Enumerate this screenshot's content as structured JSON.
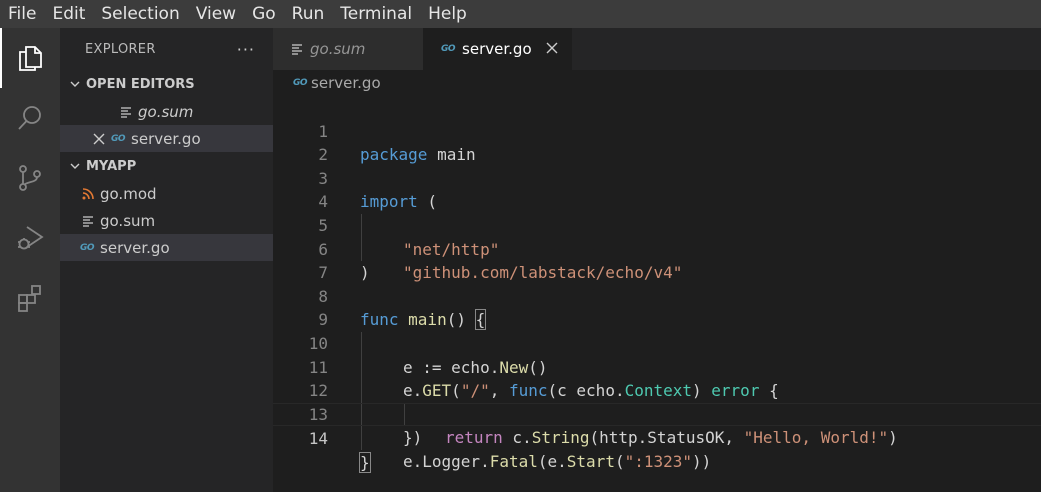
{
  "menubar": {
    "items": [
      "File",
      "Edit",
      "Selection",
      "View",
      "Go",
      "Run",
      "Terminal",
      "Help"
    ]
  },
  "activitybar": {
    "items": [
      {
        "icon": "files-icon",
        "active": true
      },
      {
        "icon": "search-icon",
        "active": false
      },
      {
        "icon": "source-control-icon",
        "active": false
      },
      {
        "icon": "run-debug-icon",
        "active": false
      },
      {
        "icon": "extensions-icon",
        "active": false
      }
    ]
  },
  "sidebar": {
    "title": "EXPLORER",
    "more": "···",
    "open_editors": {
      "label": "OPEN EDITORS",
      "items": [
        {
          "name": "go.sum",
          "icon": "lines-icon"
        },
        {
          "name": "server.go",
          "icon": "go-icon"
        }
      ]
    },
    "project": {
      "label": "MYAPP",
      "items": [
        {
          "name": "go.mod",
          "icon": "rss-icon"
        },
        {
          "name": "go.sum",
          "icon": "lines-icon"
        },
        {
          "name": "server.go",
          "icon": "go-icon"
        }
      ]
    }
  },
  "tabs": [
    {
      "label": "go.sum",
      "active": false
    },
    {
      "label": "server.go",
      "active": true
    }
  ],
  "breadcrumb": "server.go",
  "icon_text": {
    "go": "GO"
  },
  "code": {
    "current_line": 14,
    "line_numbers": [
      "1",
      "2",
      "3",
      "4",
      "5",
      "6",
      "7",
      "8",
      "9",
      "10",
      "11",
      "12",
      "13",
      "14"
    ],
    "tokens": {
      "l1_kw": "package",
      "l1_name": " main",
      "l3_kw": "import",
      "l3_paren": " (",
      "l4_str": "\"net/http\"",
      "l5_str": "\"github.com/labstack/echo/v4\"",
      "l6": ")",
      "l8_kw": "func",
      "l8_fn": " main",
      "l8_rest": "() ",
      "l8_brace": "{",
      "l9_a": "e := echo.",
      "l9_fn": "New",
      "l9_b": "()",
      "l10_a": "e.",
      "l10_fn": "GET",
      "l10_b": "(",
      "l10_str": "\"/\"",
      "l10_c": ", ",
      "l10_kw": "func",
      "l10_d": "(c echo.",
      "l10_ty": "Context",
      "l10_e": ") ",
      "l10_ty2": "error",
      "l10_f": " {",
      "l11_ctl": "return",
      "l11_a": " c.",
      "l11_fn": "String",
      "l11_b": "(http.StatusOK, ",
      "l11_str": "\"Hello, World!\"",
      "l11_c": ")",
      "l12": "})",
      "l13_a": "e.Logger.",
      "l13_fn": "Fatal",
      "l13_b": "(e.",
      "l13_fn2": "Start",
      "l13_c": "(",
      "l13_str": "\":1323\"",
      "l13_d": "))",
      "l14": "}"
    }
  }
}
